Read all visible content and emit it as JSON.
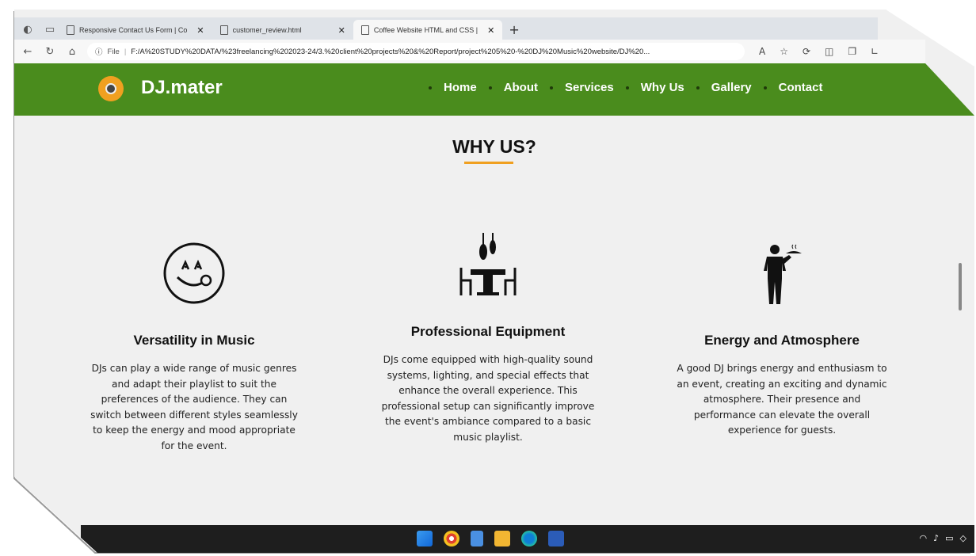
{
  "browser": {
    "tabs": [
      {
        "label": "Responsive Contact Us Form | Co"
      },
      {
        "label": "customer_review.html"
      },
      {
        "label": "Coffee Website HTML and CSS | "
      }
    ],
    "address": {
      "prefix": "File",
      "url": "F:/A%20STUDY%20DATA/%23freelancing%202023-24/3.%20client%20projects%20&%20Report/project%205%20-%20DJ%20Music%20website/DJ%20..."
    }
  },
  "header": {
    "brand": "DJ.mater",
    "nav": [
      "Home",
      "About",
      "Services",
      "Why Us",
      "Gallery",
      "Contact"
    ]
  },
  "section": {
    "title": "WHY US?",
    "cards": [
      {
        "icon": "smile-face-icon",
        "title": "Versatility in Music",
        "text": "DJs can play a wide range of music genres and adapt their playlist to suit the preferences of the audience. They can switch between different styles seamlessly to keep the energy and mood appropriate for the event."
      },
      {
        "icon": "dining-table-icon",
        "title": "Professional Equipment",
        "text": "DJs come equipped with high-quality sound systems, lighting, and special effects that enhance the overall experience. This professional setup can significantly improve the event's ambiance compared to a basic music playlist."
      },
      {
        "icon": "waiter-icon",
        "title": "Energy and Atmosphere",
        "text": "A good DJ brings energy and enthusiasm to an event, creating an exciting and dynamic atmosphere. Their presence and performance can elevate the overall experience for guests."
      }
    ]
  },
  "colors": {
    "header_bg": "#4a8c1d",
    "accent": "#f0a020",
    "taskbar": "#1e1e1e"
  }
}
